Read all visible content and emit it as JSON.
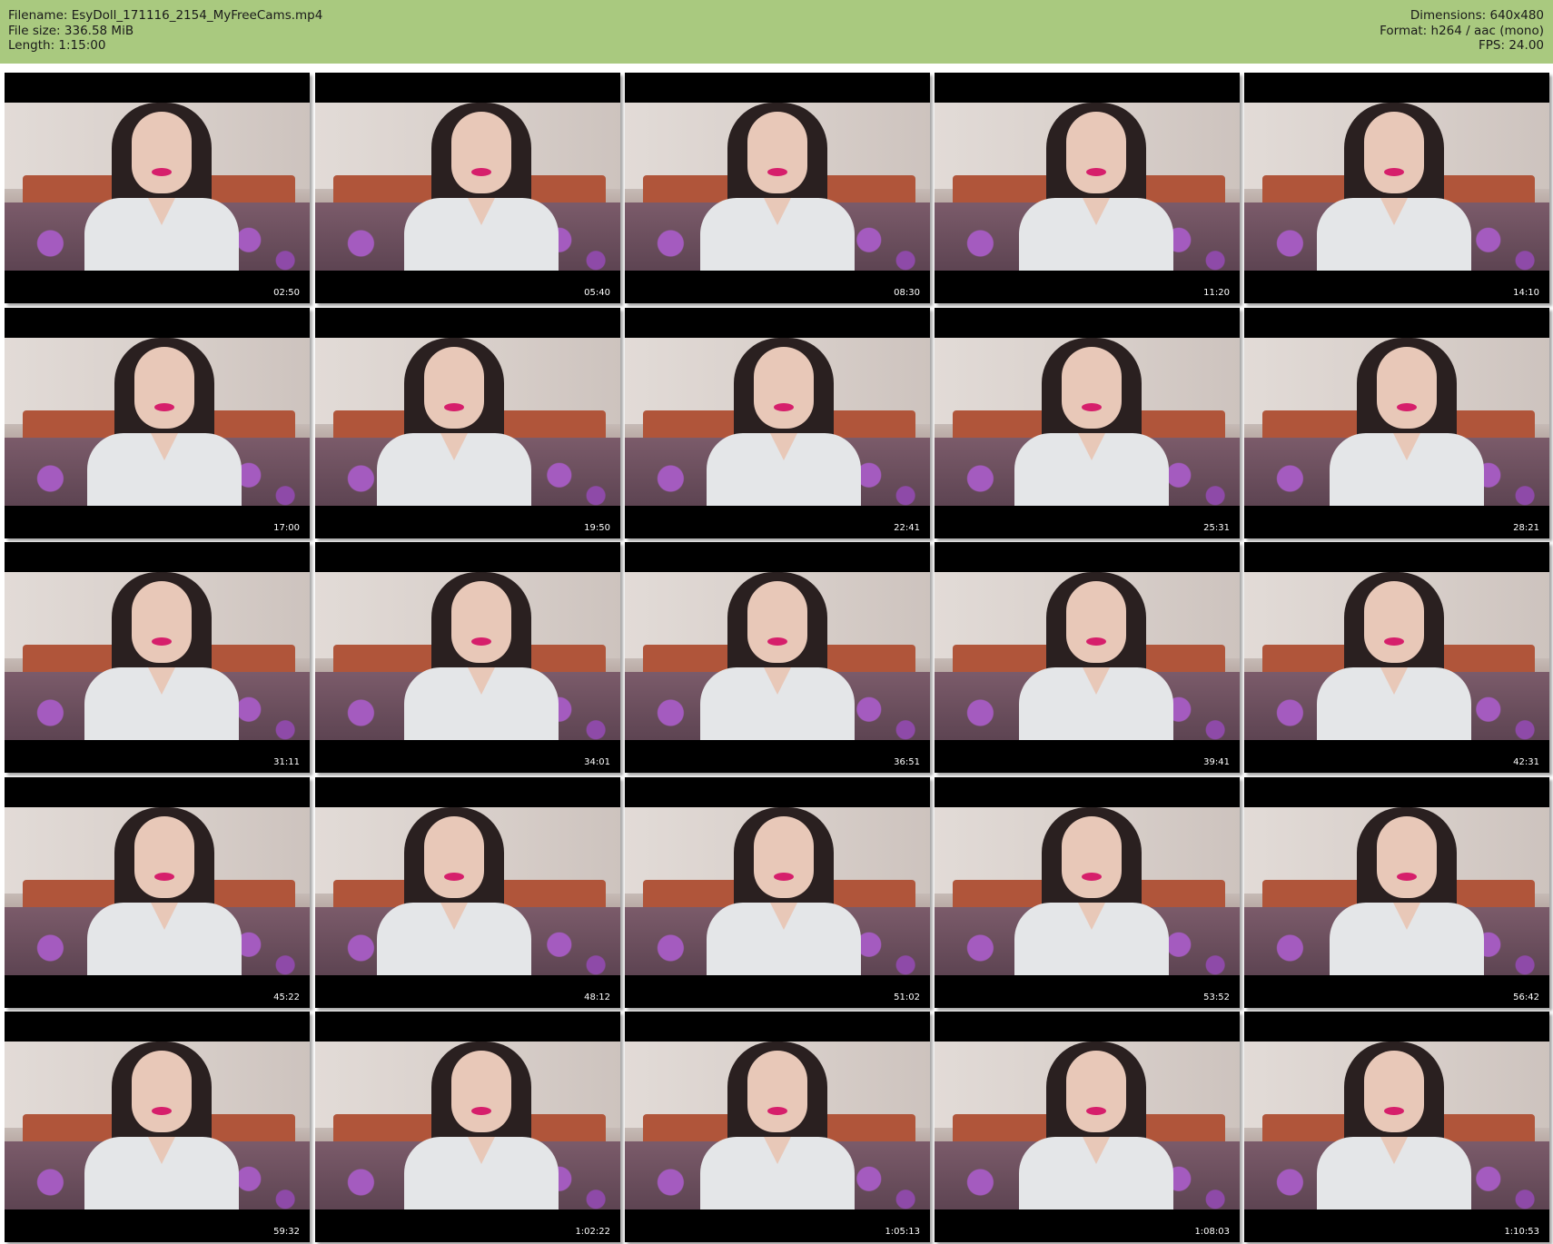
{
  "header": {
    "left": [
      "Filename: EsyDoll_171116_2154_MyFreeCams.mp4",
      "File size: 336.58 MiB",
      "Length: 1:15:00"
    ],
    "right": [
      "Dimensions: 640x480",
      "Format: h264 / aac (mono)",
      "FPS: 24.00"
    ]
  },
  "thumbnails": [
    "02:50",
    "05:40",
    "08:30",
    "11:20",
    "14:10",
    "17:00",
    "19:50",
    "22:41",
    "25:31",
    "28:21",
    "31:11",
    "34:01",
    "36:51",
    "39:41",
    "42:31",
    "45:22",
    "48:12",
    "51:02",
    "53:52",
    "56:42",
    "59:32",
    "1:02:22",
    "1:05:13",
    "1:08:03",
    "1:10:53"
  ],
  "colors": {
    "header_bg": "#a9c97f",
    "timestamp": "#ffffff",
    "lips": "#d61f6b"
  }
}
